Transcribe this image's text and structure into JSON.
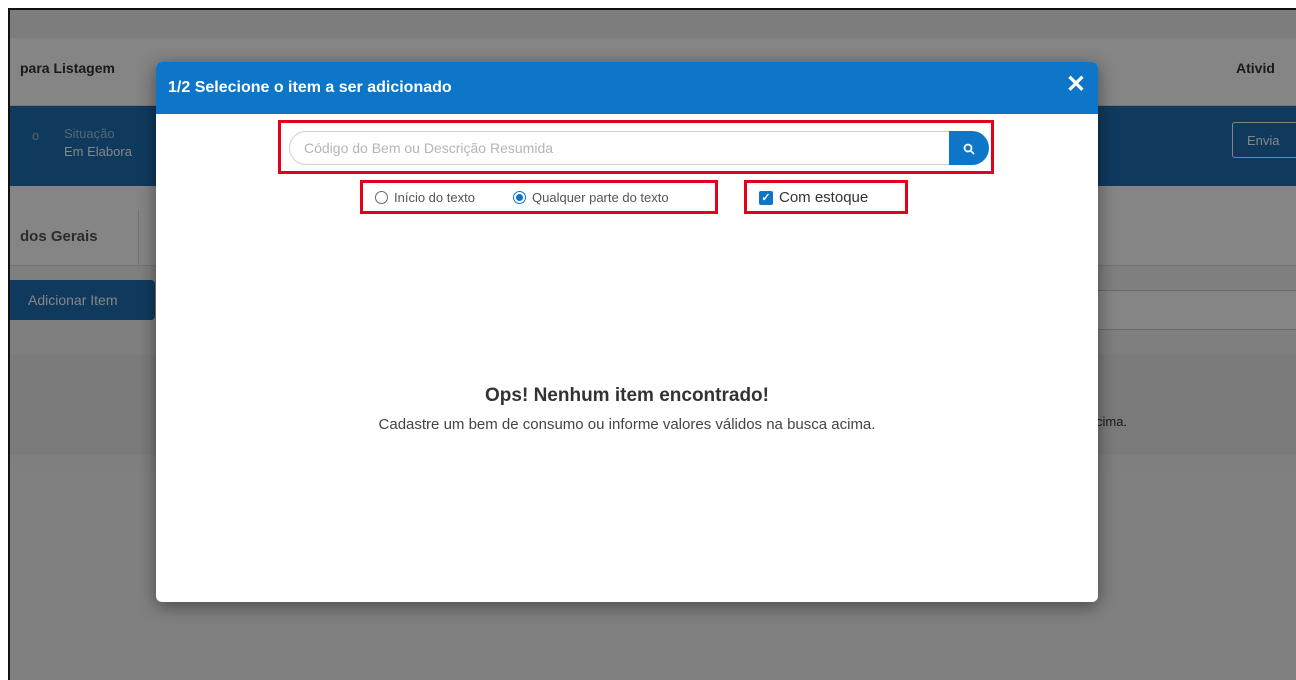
{
  "background": {
    "title": "para Listagem",
    "top_right": "Ativid",
    "bluebar": {
      "left_fragment": "o",
      "situacao_label": "Situação",
      "situacao_value": "Em Elabora",
      "enviar_label": "Envia"
    },
    "tab_label": "dos Gerais",
    "add_button": "Adicionar Item",
    "trailing_text": "cima."
  },
  "modal": {
    "title": "1/2 Selecione o item a ser adicionado",
    "close_glyph": "✕",
    "search": {
      "placeholder": "Código do Bem ou Descrição Resumida",
      "value": "",
      "button_icon": "search-icon"
    },
    "radio_options": [
      {
        "label": "Início do texto",
        "checked": false
      },
      {
        "label": "Qualquer parte do texto",
        "checked": true
      }
    ],
    "checkbox": {
      "label": "Com estoque",
      "checked": true
    },
    "empty_state": {
      "title": "Ops! Nenhum item encontrado!",
      "message": "Cadastre um bem de consumo ou informe valores válidos na busca acima."
    }
  },
  "colors": {
    "primary_blue": "#0d76c8",
    "highlight_red": "#e3001b"
  }
}
